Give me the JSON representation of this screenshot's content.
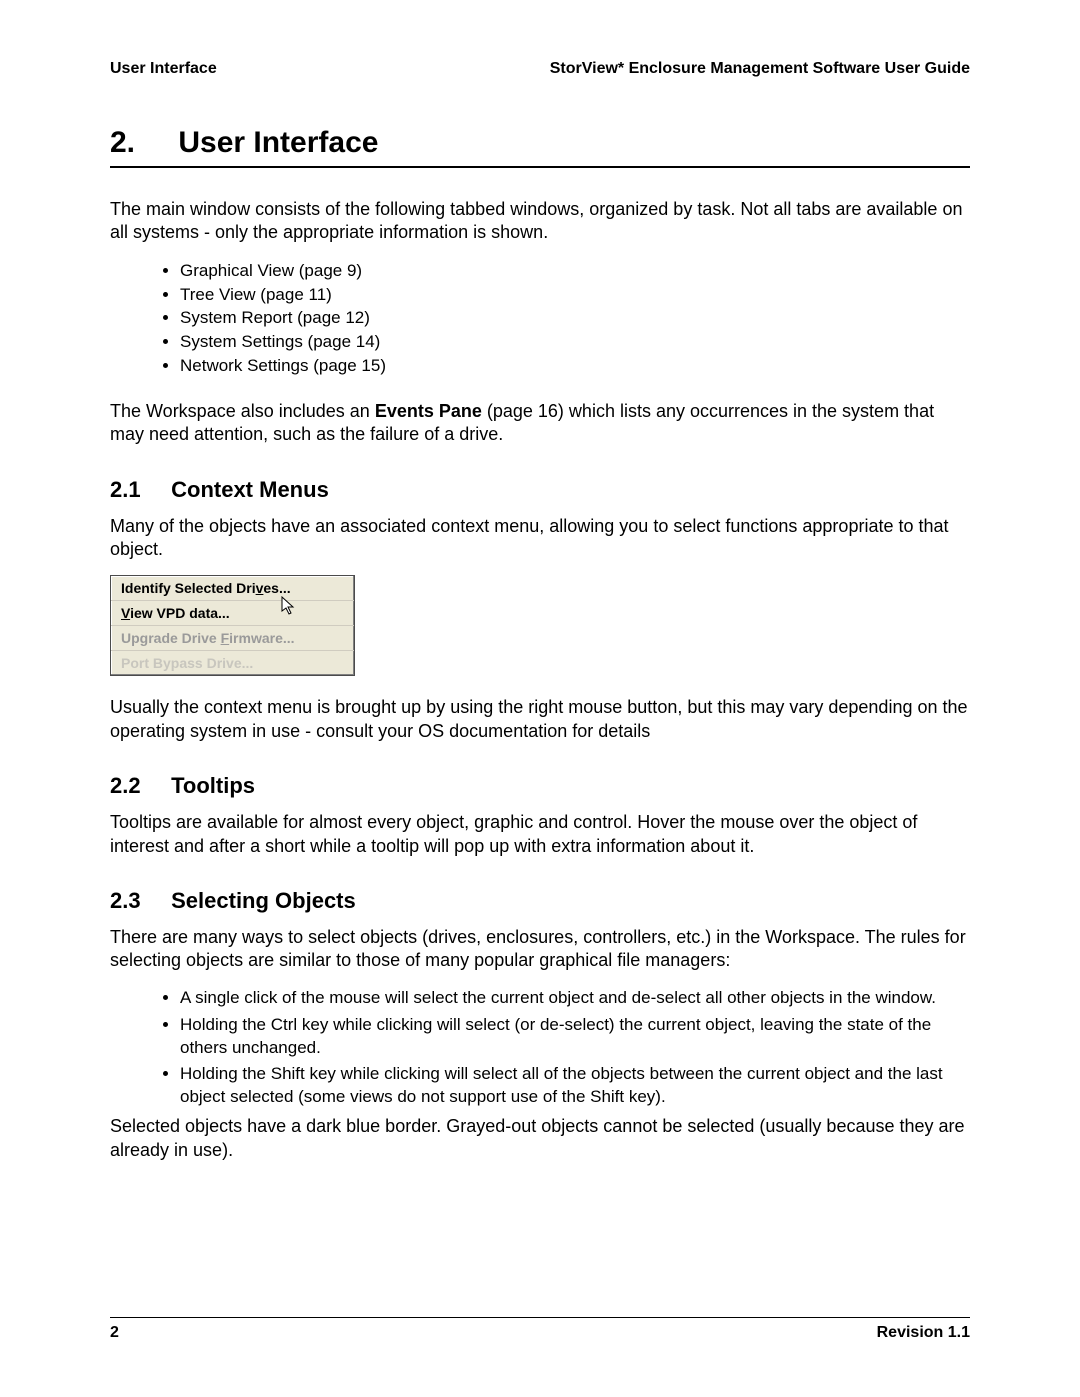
{
  "header": {
    "left": "User Interface",
    "right": "StorView* Enclosure Management Software User Guide"
  },
  "chapter": {
    "number": "2.",
    "title": "User Interface"
  },
  "intro1": "The main window consists of the following tabbed windows, organized by task. Not all tabs are available on all systems - only the appropriate information is shown.",
  "tabs": [
    "Graphical View (page 9)",
    "Tree View (page 11)",
    "System Report (page 12)",
    "System Settings (page 14)",
    "Network Settings (page 15)"
  ],
  "events_line_pre": "The Workspace also includes an ",
  "events_bold": "Events Pane",
  "events_line_post": " (page 16) which lists any occurrences in the system that may need attention, such as the failure of a drive.",
  "s21": {
    "num": "2.1",
    "title": "Context Menus"
  },
  "s21_text": "Many of the objects have an associated context menu, allowing you to select functions appropriate to that object.",
  "context_menu": {
    "item1_pre": "Identify Selected Dri",
    "item1_u": "v",
    "item1_post": "es...",
    "item2_u": "V",
    "item2_post": "iew VPD data...",
    "item3_pre": "Upgrade Drive ",
    "item3_u": "F",
    "item3_post": "irmware...",
    "item4": "Port Bypass Drive..."
  },
  "s21_after": "Usually the context menu is brought up by using the right mouse button, but this may vary depending on the operating system in use - consult your OS documentation for details",
  "s22": {
    "num": "2.2",
    "title": "Tooltips"
  },
  "s22_text": "Tooltips are available for almost every object, graphic and control. Hover the mouse over the object of interest and after a short while a tooltip will pop up with extra information about it.",
  "s23": {
    "num": "2.3",
    "title": "Selecting Objects"
  },
  "s23_intro": "There are many ways to select objects (drives, enclosures, controllers, etc.) in the Workspace. The rules for selecting objects are similar to those of many popular graphical file managers:",
  "s23_rules": [
    "A single click of the mouse will select the current object and de-select all other objects in the window.",
    "Holding the Ctrl key while clicking will select (or de-select) the current object, leaving the state of the others unchanged.",
    "Holding the Shift key while clicking will select all of the objects between the current object and the last object selected (some views do not support use of the Shift key)."
  ],
  "s23_after": "Selected objects have a dark blue border. Grayed-out objects cannot be selected (usually because they are already in use).",
  "footer": {
    "page": "2",
    "revision": "Revision 1.1"
  }
}
